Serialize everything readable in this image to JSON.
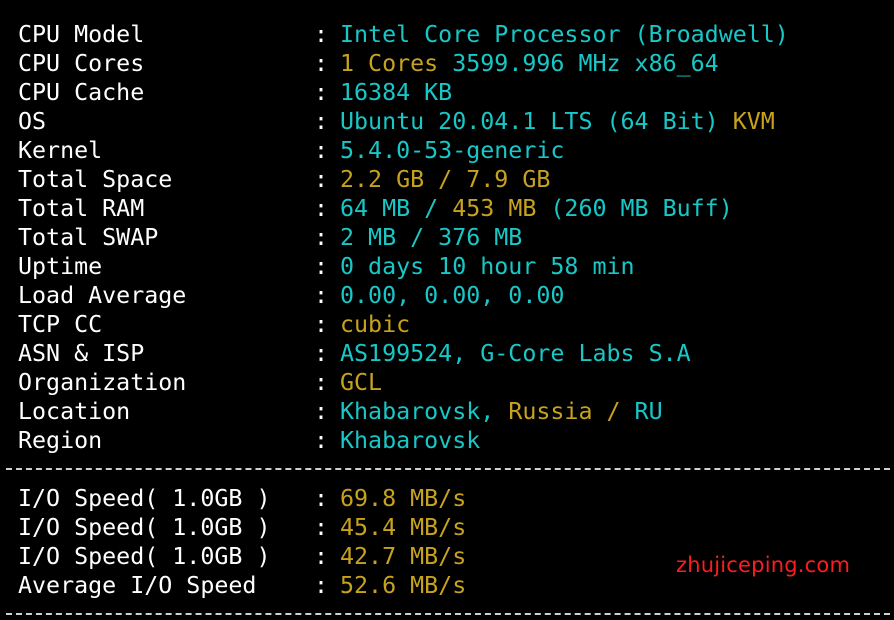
{
  "sysinfo": {
    "separator": ":",
    "rows": [
      {
        "label": "CPU Model",
        "parts": [
          {
            "text": "Intel Core Processor (Broadwell)",
            "color": "cyan"
          }
        ]
      },
      {
        "label": "CPU Cores",
        "parts": [
          {
            "text": "1 Cores ",
            "color": "yellow"
          },
          {
            "text": "3599.996 MHz x86_64",
            "color": "cyan"
          }
        ]
      },
      {
        "label": "CPU Cache",
        "parts": [
          {
            "text": "16384 KB",
            "color": "cyan"
          }
        ]
      },
      {
        "label": "OS",
        "parts": [
          {
            "text": "Ubuntu 20.04.1 LTS (64 Bit) ",
            "color": "cyan"
          },
          {
            "text": "KVM",
            "color": "yellow"
          }
        ]
      },
      {
        "label": "Kernel",
        "parts": [
          {
            "text": "5.4.0-53-generic",
            "color": "cyan"
          }
        ]
      },
      {
        "label": "Total Space",
        "parts": [
          {
            "text": "2.2 GB / ",
            "color": "yellow"
          },
          {
            "text": "7.9 GB",
            "color": "yellow"
          }
        ]
      },
      {
        "label": "Total RAM",
        "parts": [
          {
            "text": "64 MB / ",
            "color": "cyan"
          },
          {
            "text": "453 MB",
            "color": "yellow"
          },
          {
            "text": " (260 MB Buff)",
            "color": "cyan"
          }
        ]
      },
      {
        "label": "Total SWAP",
        "parts": [
          {
            "text": "2 MB / 376 MB",
            "color": "cyan"
          }
        ]
      },
      {
        "label": "Uptime",
        "parts": [
          {
            "text": "0 days 10 hour 58 min",
            "color": "cyan"
          }
        ]
      },
      {
        "label": "Load Average",
        "parts": [
          {
            "text": "0.00, 0.00, 0.00",
            "color": "cyan"
          }
        ]
      },
      {
        "label": "TCP CC",
        "parts": [
          {
            "text": "cubic",
            "color": "yellow"
          }
        ]
      },
      {
        "label": "ASN & ISP",
        "parts": [
          {
            "text": "AS199524, G-Core Labs S.A",
            "color": "cyan"
          }
        ]
      },
      {
        "label": "Organization",
        "parts": [
          {
            "text": "GCL",
            "color": "yellow"
          }
        ]
      },
      {
        "label": "Location",
        "parts": [
          {
            "text": "Khabarovsk, ",
            "color": "cyan"
          },
          {
            "text": "Russia / ",
            "color": "yellow"
          },
          {
            "text": "RU",
            "color": "cyan"
          }
        ]
      },
      {
        "label": "Region",
        "parts": [
          {
            "text": "Khabarovsk",
            "color": "cyan"
          }
        ]
      }
    ]
  },
  "io": {
    "rows": [
      {
        "label": "I/O Speed( 1.0GB )",
        "value": "69.8 MB/s"
      },
      {
        "label": "I/O Speed( 1.0GB )",
        "value": "45.4 MB/s"
      },
      {
        "label": "I/O Speed( 1.0GB )",
        "value": "42.7 MB/s"
      },
      {
        "label": "Average I/O Speed",
        "value": "52.6 MB/s"
      }
    ]
  },
  "watermark": "zhujiceping.com",
  "colors": {
    "background": "#000000",
    "label": "#ffffff",
    "cyan": "#19c7c7",
    "yellow": "#c7a21f",
    "watermark": "#ff1c1c",
    "divider": "#d0d0d0"
  }
}
